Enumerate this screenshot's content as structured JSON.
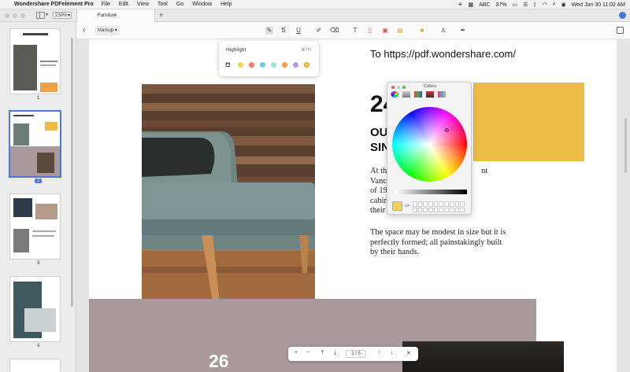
{
  "menubar": {
    "app_name": "Wondershare PDFelement Pro",
    "items": [
      "File",
      "Edit",
      "View",
      "Tool",
      "Go",
      "Window",
      "Help"
    ],
    "input_source": "ABC",
    "battery": "37%",
    "datetime": "Wed Jun 30  11:02 AM"
  },
  "titlebar": {
    "zoom": "230%",
    "tab_title": "Furniture"
  },
  "toolbar": {
    "mode": "Markup"
  },
  "highlight_popover": {
    "title": "Highlight",
    "shortcut": "⌘^H",
    "swatches": [
      "#f3d651",
      "#ef7b6c",
      "#6ec9e8",
      "#a4dedd",
      "#f0a04b",
      "#b49be0",
      "#f2c553"
    ]
  },
  "colors_panel": {
    "title": "Colors",
    "current_color": "#f5cd5a"
  },
  "sidebar": {
    "pages": [
      "1",
      "2",
      "3",
      "4"
    ],
    "selected_page": "2"
  },
  "document": {
    "link_text": "To https://pdf.wondershare.com/",
    "big_number": "24",
    "heading_line1": "OUR",
    "heading_line2": "SINC",
    "para1": [
      "At the b",
      "Vancouve",
      "of 1965, a",
      "cabinetm",
      "their new"
    ],
    "para1_right": [
      "nt",
      "",
      "",
      "",
      ""
    ],
    "para2": [
      "The space may be modest in size but it is",
      "perfectly formed; all painstakingly built",
      "by their hands."
    ],
    "bottom_number": "26"
  },
  "pagenav": {
    "current_page": "2",
    "separator": "/",
    "total_pages": "5"
  },
  "colors": {
    "accent": "#4a78d6",
    "yellow_block": "#ebbd45",
    "mauve_band": "#a9999a"
  }
}
